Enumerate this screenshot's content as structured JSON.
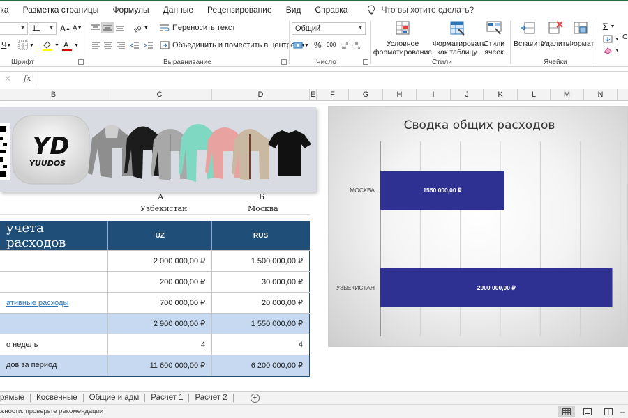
{
  "menu": {
    "items": [
      "вка",
      "Разметка страницы",
      "Формулы",
      "Данные",
      "Рецензирование",
      "Вид",
      "Справка"
    ],
    "tell_me": "Что вы хотите сделать?"
  },
  "ribbon": {
    "font_name": "",
    "font_size": "11",
    "wrap_text": "Переносить текст",
    "merge_center": "Объединить и поместить в центре",
    "number_format": "Общий",
    "conditional_formatting": "Условное форматирование",
    "format_as_table": "Форматировать как таблицу",
    "cell_styles": "Стили ячеек",
    "insert": "Вставить",
    "delete": "Удалить",
    "format": "Формат",
    "partial_right": "Со и",
    "groups": {
      "font": "Шрифт",
      "alignment": "Выравнивание",
      "number": "Число",
      "styles": "Стили",
      "cells": "Ячейки"
    }
  },
  "formula_bar": {
    "fx": "fx",
    "value": ""
  },
  "columns": [
    "B",
    "C",
    "D",
    "E",
    "F",
    "G",
    "H",
    "I",
    "J",
    "K",
    "L",
    "M",
    "N"
  ],
  "banner": {
    "logo_text": "YUUDOS"
  },
  "table": {
    "letters": [
      "А",
      "Б"
    ],
    "cities": [
      "Узбекистан",
      "Москва"
    ],
    "title": "учета расходов",
    "col_headers": [
      "UZ",
      "RUS"
    ],
    "rows": [
      {
        "label": "",
        "uz": "2 000 000,00 ₽",
        "rus": "1 500 000,00 ₽"
      },
      {
        "label": "",
        "uz": "200 000,00 ₽",
        "rus": "30 000,00 ₽"
      },
      {
        "label": "ативные расходы",
        "uz": "700 000,00 ₽",
        "rus": "20 000,00 ₽"
      },
      {
        "label": "",
        "uz": "2 900 000,00 ₽",
        "rus": "1 550 000,00 ₽"
      },
      {
        "label": "о недель",
        "uz": "4",
        "rus": "4"
      },
      {
        "label": "дов за период",
        "uz": "11 600 000,00 ₽",
        "rus": "6 200 000,00 ₽"
      }
    ]
  },
  "chart_data": {
    "type": "bar",
    "orientation": "horizontal",
    "title": "Сводка общих расходов",
    "categories": [
      "МОСКВА",
      "УЗБЕКИСТАН"
    ],
    "values": [
      1550000,
      2900000
    ],
    "data_labels": [
      "1550 000,00 ₽",
      "2900 000,00 ₽"
    ],
    "xlim": [
      0,
      3000000
    ],
    "bar_color": "#2e3192",
    "grid": true,
    "legend": "none"
  },
  "sheet_tabs": [
    "рямые",
    "Косвенные",
    "Общие и адм",
    "Расчет 1",
    "Расчет 2"
  ],
  "status": {
    "text": "жности: проверьте рекомендации"
  },
  "colors": {
    "excel_green": "#1e7145",
    "header_blue": "#1f4e79",
    "row_blue": "#c6d9f0",
    "bar": "#2e3192"
  }
}
